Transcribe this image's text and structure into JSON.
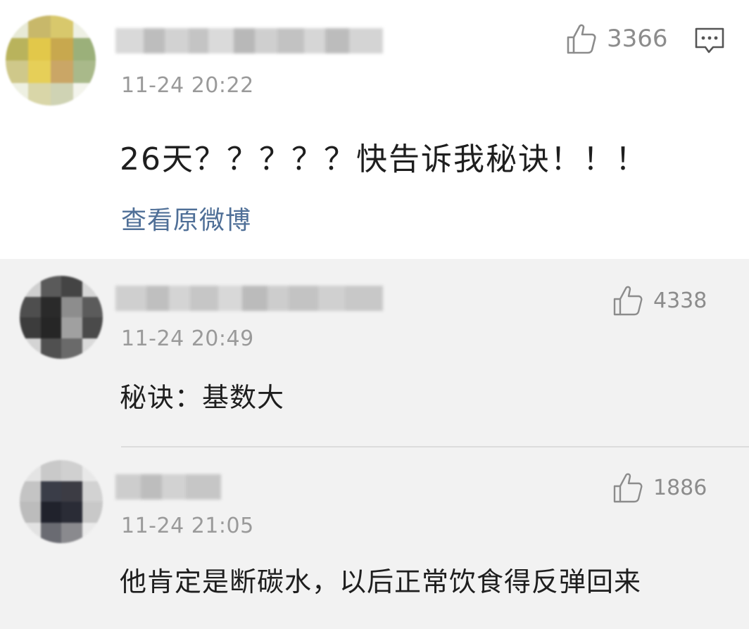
{
  "main_comment": {
    "timestamp": "11-24 20:22",
    "text": "26天？？？？？快告诉我秘诀！！！",
    "likes": "3366",
    "view_original_label": "查看原微博",
    "like_icon": "thumbs-up-icon",
    "comment_icon": "comment-bubble-icon"
  },
  "replies": [
    {
      "timestamp": "11-24 20:49",
      "text": "秘诀：基数大",
      "likes": "4338",
      "like_icon": "thumbs-up-icon"
    },
    {
      "timestamp": "11-24 21:05",
      "text": "他肯定是断碳水，以后正常饮食得反弹回来",
      "likes": "1886",
      "like_icon": "thumbs-up-icon"
    }
  ],
  "colors": {
    "link": "#4f6f97",
    "timestamp": "#9a9a9a",
    "page_bg": "#ffffff",
    "reply_bg": "#f2f2f2"
  }
}
